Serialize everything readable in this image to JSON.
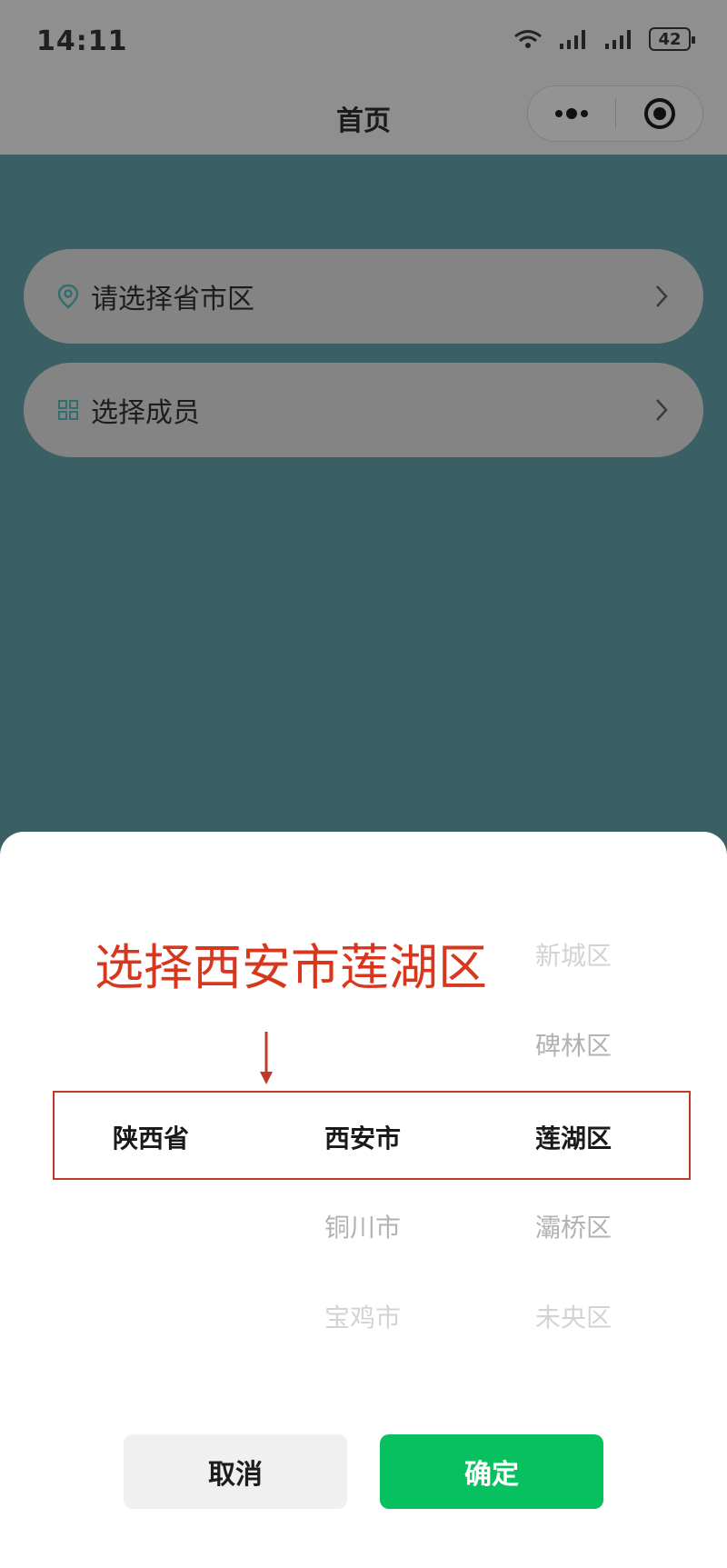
{
  "status_bar": {
    "time": "14:11",
    "battery": "42"
  },
  "nav": {
    "title": "首页"
  },
  "rows": [
    {
      "label": "请选择省市区",
      "icon": "location-pin-icon"
    },
    {
      "label": "选择成员",
      "icon": "grid-icon"
    }
  ],
  "annotation": "选择西安市莲湖区",
  "picker": {
    "province": {
      "selected": "陕西省"
    },
    "city": {
      "selected": "西安市",
      "below": [
        "铜川市",
        "宝鸡市"
      ]
    },
    "district": {
      "above": [
        "新城区",
        "碑林区"
      ],
      "selected": "莲湖区",
      "below": [
        "灞桥区",
        "未央区"
      ]
    }
  },
  "buttons": {
    "cancel": "取消",
    "confirm": "确定"
  },
  "colors": {
    "accent": "#07c160",
    "annotation": "#d8371d",
    "overlay_bg": "#3a5f64"
  }
}
